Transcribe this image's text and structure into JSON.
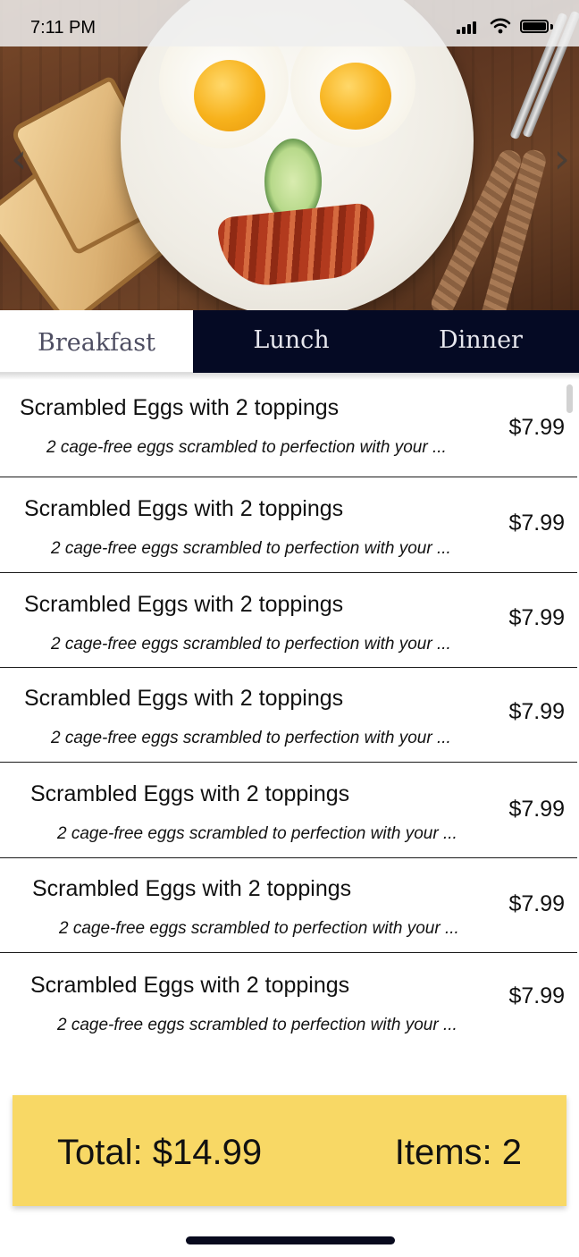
{
  "status_bar": {
    "time": "7:11 PM"
  },
  "hero": {
    "prev_icon": "chevron-left-icon",
    "next_icon": "chevron-right-icon"
  },
  "tabs": [
    {
      "label": "Breakfast",
      "active": true
    },
    {
      "label": "Lunch",
      "active": false
    },
    {
      "label": "Dinner",
      "active": false
    }
  ],
  "menu_items": [
    {
      "name": "Scrambled Eggs with 2 toppings",
      "description": "2 cage-free eggs scrambled to perfection with your ...",
      "price": "$7.99"
    },
    {
      "name": "Scrambled Eggs with 2 toppings",
      "description": "2 cage-free eggs scrambled to perfection with your ...",
      "price": "$7.99"
    },
    {
      "name": "Scrambled Eggs with 2 toppings",
      "description": "2 cage-free eggs scrambled to perfection with your ...",
      "price": "$7.99"
    },
    {
      "name": "Scrambled Eggs with 2 toppings",
      "description": "2 cage-free eggs scrambled to perfection with your ...",
      "price": "$7.99"
    },
    {
      "name": "Scrambled Eggs with 2 toppings",
      "description": "2 cage-free eggs scrambled to perfection with your ...",
      "price": "$7.99"
    },
    {
      "name": "Scrambled Eggs with 2 toppings",
      "description": "2 cage-free eggs scrambled to perfection with your ...",
      "price": "$7.99"
    },
    {
      "name": "Scrambled Eggs with 2 toppings",
      "description": "2 cage-free eggs scrambled to perfection with your ...",
      "price": "$7.99"
    }
  ],
  "summary": {
    "total": "Total: $14.99",
    "items": "Items: 2"
  },
  "colors": {
    "tab_bar": "#050a24",
    "total_bar": "#f8d865",
    "active_tab_text": "#4e4e62"
  }
}
